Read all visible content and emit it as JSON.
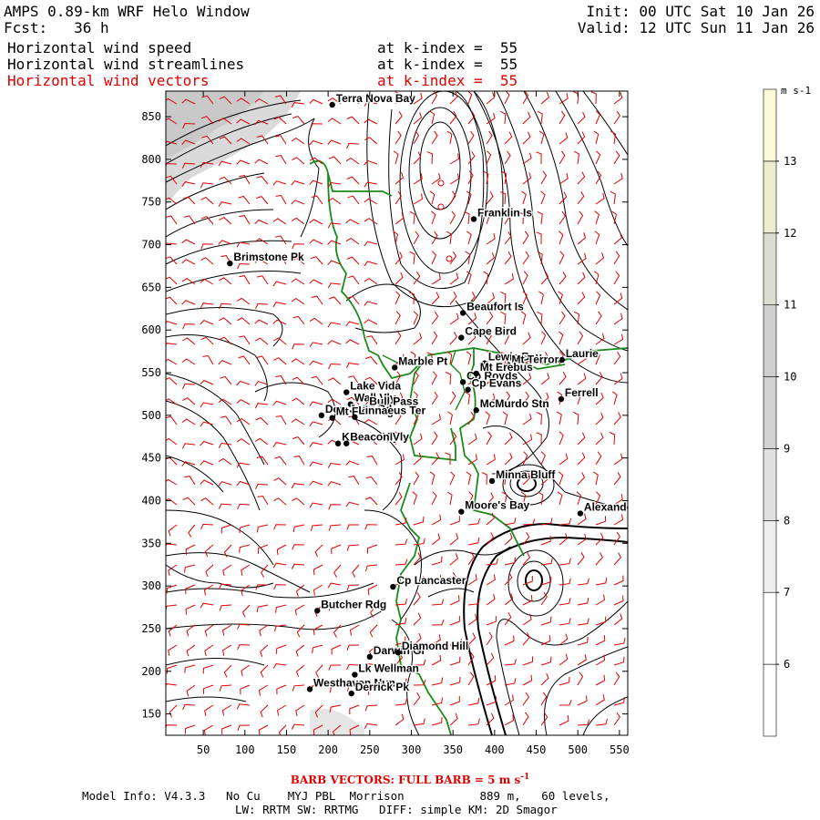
{
  "header": {
    "title": "AMPS 0.89-km WRF Helo Window",
    "fcst_label": "Fcst:",
    "fcst_value": "36 h",
    "init": "Init: 00 UTC Sat 10 Jan 26",
    "valid": "Valid: 12 UTC Sun 11 Jan 26",
    "fields": [
      {
        "name": "Horizontal wind speed",
        "level": "at k-index =  55",
        "color": "#000000"
      },
      {
        "name": "Horizontal wind streamlines",
        "level": "at k-index =  55",
        "color": "#000000"
      },
      {
        "name": "Horizontal wind vectors",
        "level": "at k-index =  55",
        "color": "#e00000"
      }
    ]
  },
  "map": {
    "x_ticks": [
      50,
      100,
      150,
      200,
      250,
      300,
      350,
      400,
      450,
      500,
      550
    ],
    "y_ticks": [
      150,
      200,
      250,
      300,
      350,
      400,
      450,
      500,
      550,
      600,
      650,
      700,
      750,
      800,
      850
    ],
    "x_range": [
      5,
      560
    ],
    "y_range": [
      125,
      880
    ],
    "places": [
      {
        "name": "Terra Nova Bay",
        "x": 205,
        "y": 864
      },
      {
        "name": "Franklin Is",
        "x": 375,
        "y": 730
      },
      {
        "name": "Brimstone Pk",
        "x": 82,
        "y": 678
      },
      {
        "name": "Beaufort Is",
        "x": 362,
        "y": 620
      },
      {
        "name": "Cape Bird",
        "x": 360,
        "y": 591
      },
      {
        "name": "Lewis Bay",
        "x": 388,
        "y": 561
      },
      {
        "name": "Laurie",
        "x": 481,
        "y": 565
      },
      {
        "name": "Mt Terror",
        "x": 416,
        "y": 558
      },
      {
        "name": "Marble Pt",
        "x": 280,
        "y": 556
      },
      {
        "name": "Cp Royds",
        "x": 362,
        "y": 539
      },
      {
        "name": "Mt Erebus",
        "x": 378,
        "y": 549
      },
      {
        "name": "Lake Vida",
        "x": 222,
        "y": 527
      },
      {
        "name": "Cp Evans",
        "x": 368,
        "y": 530
      },
      {
        "name": "Ferrell",
        "x": 480,
        "y": 519
      },
      {
        "name": "Wall Vly",
        "x": 227,
        "y": 513
      },
      {
        "name": "Bull Pass",
        "x": 245,
        "y": 509
      },
      {
        "name": "McMurdo Stn",
        "x": 378,
        "y": 506
      },
      {
        "name": "Don Juan Pd",
        "x": 192,
        "y": 500
      },
      {
        "name": "Mt Fleming",
        "x": 205,
        "y": 497
      },
      {
        "name": "Linnaeus Ter",
        "x": 232,
        "y": 498
      },
      {
        "name": "Kennar Vly",
        "x": 212,
        "y": 467
      },
      {
        "name": "Beacon Vly",
        "x": 222,
        "y": 467
      },
      {
        "name": "Minna Bluff",
        "x": 397,
        "y": 423
      },
      {
        "name": "Moore's Bay",
        "x": 360,
        "y": 387
      },
      {
        "name": "Alexander",
        "x": 503,
        "y": 385
      },
      {
        "name": "Cp Lancaster",
        "x": 278,
        "y": 299
      },
      {
        "name": "Butcher Rdg",
        "x": 187,
        "y": 271
      },
      {
        "name": "Darwin Gl",
        "x": 250,
        "y": 217
      },
      {
        "name": "Diamond Hill",
        "x": 284,
        "y": 222
      },
      {
        "name": "Lk Wellman",
        "x": 232,
        "y": 196
      },
      {
        "name": "Westhaven Nun",
        "x": 178,
        "y": 179
      },
      {
        "name": "Derrick Pk",
        "x": 228,
        "y": 174
      }
    ]
  },
  "colorbar": {
    "unit": "m s-1",
    "labels": [
      "6",
      "7",
      "8",
      "9",
      "10",
      "11",
      "12",
      "13"
    ],
    "range": [
      5,
      14
    ],
    "colors": [
      "#ffffff",
      "#ffffff",
      "#eeeeee",
      "#e0e0e0",
      "#d2d2d2",
      "#cfcfcf",
      "#dcdccf",
      "#ececcf",
      "#fcfad8"
    ]
  },
  "footer": {
    "barb_note": "BARB VECTORS: FULL BARB = 5 m s",
    "barb_exp": "-1",
    "model_info": "Model Info: V4.3.3   No Cu    MYJ PBL  Morrison           889 m,   60 levels,",
    "physics": "LW: RRTM SW: RRTMG   DIFF: simple KM: 2D Smagor"
  },
  "colors": {
    "coast": "#1a8a1a",
    "vectors": "#e00000",
    "shading": "#d4d4d4"
  }
}
